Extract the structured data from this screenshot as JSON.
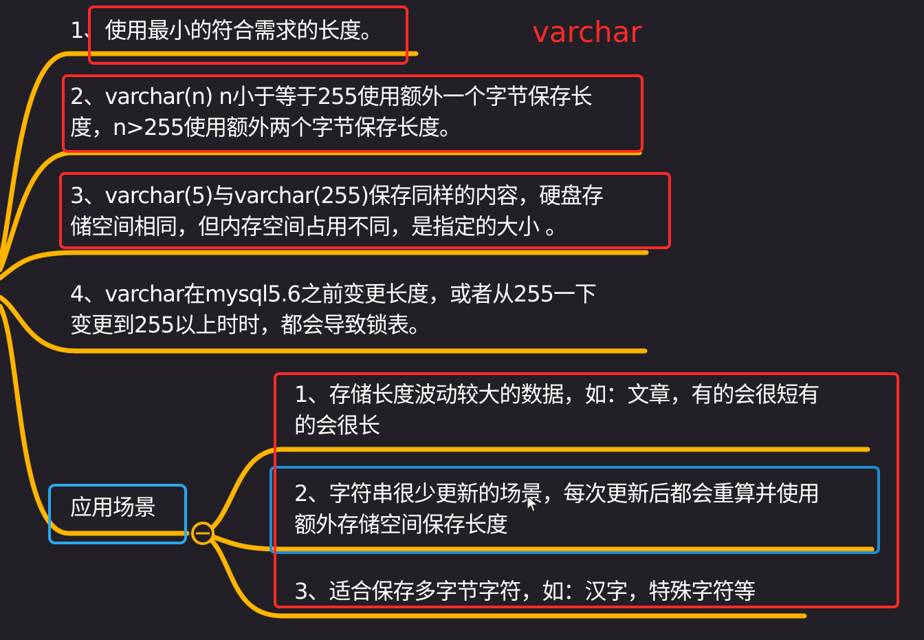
{
  "annotation_title": "varchar",
  "colors": {
    "branch": "#ffb400",
    "annotation_red": "#ff2a2a",
    "highlight_blue": "#1e8fd6",
    "topic_blue": "#29a8f0",
    "background": "#221f26"
  },
  "characteristics": [
    {
      "text": "1、使用最小的符合需求的长度。"
    },
    {
      "text": "2、varchar(n) n小于等于255使用额外一个字节保存长\n度，n>255使用额外两个字节保存长度。"
    },
    {
      "text": "3、varchar(5)与varchar(255)保存同样的内容，硬盘存\n储空间相同，但内存空间占用不同，是指定的大小 。"
    },
    {
      "text": "4、varchar在mysql5.6之前变更长度，或者从255一下\n变更到255以上时时，都会导致锁表。"
    }
  ],
  "scenario_topic": {
    "label": "应用场景",
    "collapse_icon": "minus-circle-icon"
  },
  "scenarios": [
    {
      "text": "1、存储长度波动较大的数据，如：文章，有的会很短有\n的会很长"
    },
    {
      "text": "2、字符串很少更新的场景，每次更新后都会重算并使用\n额外存储空间保存长度"
    },
    {
      "text": "3、适合保存多字节字符，如：汉字，特殊字符等"
    }
  ],
  "cursor_icon": "mouse-pointer-icon"
}
